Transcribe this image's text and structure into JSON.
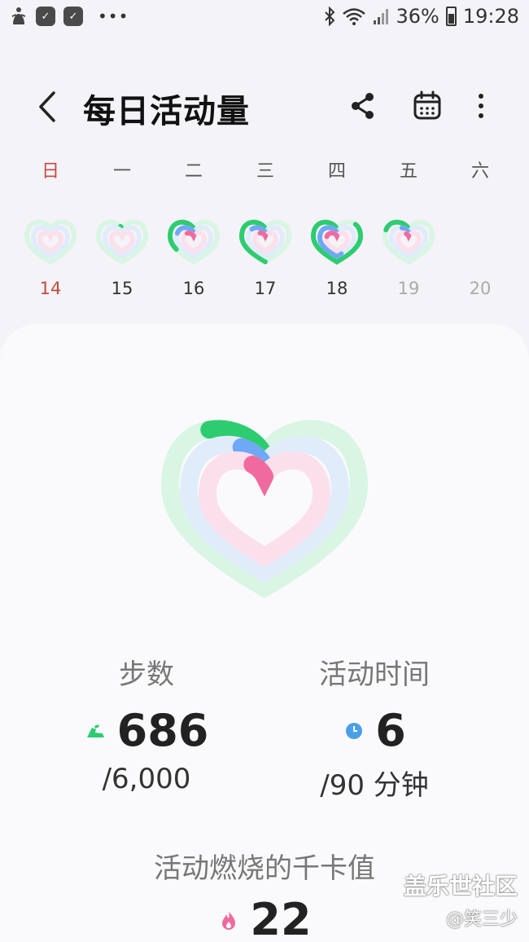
{
  "status_bar": {
    "dots": "•••",
    "battery": "36%",
    "time": "19:28"
  },
  "header": {
    "title": "每日活动量",
    "icons": [
      "back-icon",
      "share-icon",
      "calendar-icon",
      "more-icon"
    ]
  },
  "week": {
    "days": [
      {
        "label": "日",
        "date": "14",
        "steps_progress": 0,
        "active_progress": 0,
        "calorie_progress": 0
      },
      {
        "label": "一",
        "date": "15",
        "steps_progress": 0.02,
        "active_progress": 0,
        "calorie_progress": 0
      },
      {
        "label": "二",
        "date": "16",
        "steps_progress": 0.35,
        "active_progress": 0.2,
        "calorie_progress": 0.12
      },
      {
        "label": "三",
        "date": "17",
        "steps_progress": 0.5,
        "active_progress": 0.15,
        "calorie_progress": 0.1
      },
      {
        "label": "四",
        "date": "18",
        "steps_progress": 0.85,
        "active_progress": 0.55,
        "calorie_progress": 0.2
      },
      {
        "label": "五",
        "date": "19",
        "steps_progress": 0.2,
        "active_progress": 0.08,
        "calorie_progress": 0.05
      },
      {
        "label": "六",
        "date": "20",
        "steps_progress": null,
        "active_progress": null,
        "calorie_progress": null
      }
    ]
  },
  "summary": {
    "steps": {
      "label": "步数",
      "value": "686",
      "goal": "/6,000",
      "progress": 0.114
    },
    "active_time": {
      "label": "活动时间",
      "value": "6",
      "goal": "/90 分钟",
      "progress": 0.067
    },
    "calories": {
      "label": "活动燃烧的千卡值",
      "value": "22",
      "progress": 0.05
    }
  },
  "watermark": {
    "line1": "盖乐世社区",
    "line2": "@笑三少"
  },
  "colors": {
    "steps": "#2ecc71",
    "active": "#6fa8f5",
    "calories": "#f06aa0",
    "sunday": "#c64a3e"
  }
}
